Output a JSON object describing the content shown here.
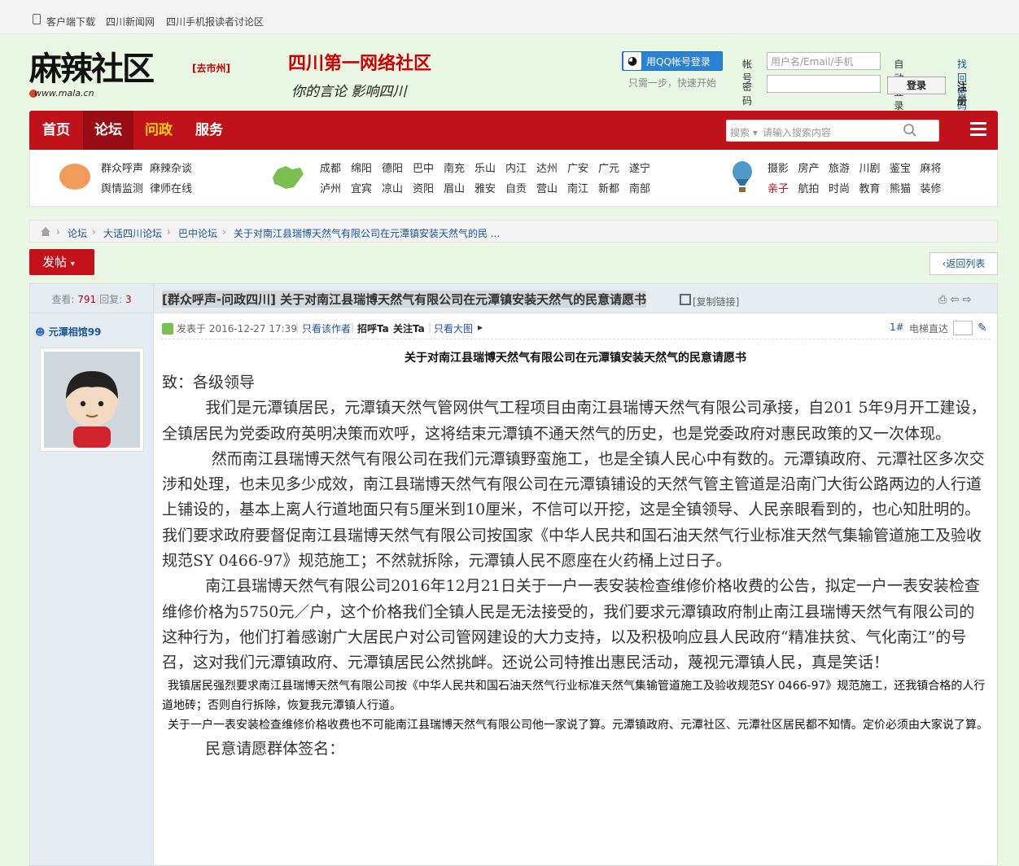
{
  "topbar": {
    "client_download": "客户端下载",
    "sichuan_news": "四川新闻网",
    "reader_forum": "四川手机报读者讨论区"
  },
  "header": {
    "logo_text": "麻辣社区",
    "logo_url": "www.mala.cn",
    "city_link": "[去市州]",
    "slogan_main": "四川第一网络社区",
    "slogan_sub": "你的言论 影响四川",
    "qq_login": "用QQ帐号登录",
    "qq_tip": "只需一步，快速开始",
    "account_label": "帐号",
    "account_placeholder": "用户名/Email/手机",
    "password_label": "密码",
    "auto_login": "自动登录",
    "find_password": "找回密码",
    "login_button": "登录",
    "register": "注册"
  },
  "nav": {
    "home": "首页",
    "forum": "论坛",
    "wenzheng": "问政",
    "service": "服务",
    "search_label": "搜索",
    "search_placeholder": "请输入搜索内容"
  },
  "subnav": {
    "group1": [
      "群众呼声",
      "麻辣杂谈",
      "舆情监测",
      "律师在线"
    ],
    "cities_row1": [
      "成都",
      "绵阳",
      "德阳",
      "巴中",
      "南充",
      "乐山",
      "内江",
      "达州",
      "广安",
      "广元",
      "遂宁"
    ],
    "cities_row2": [
      "泸州",
      "宜宾",
      "凉山",
      "资阳",
      "眉山",
      "雅安",
      "自贡",
      "营山",
      "南江",
      "新都",
      "南部"
    ],
    "topics_row1": [
      "摄影",
      "房产",
      "旅游",
      "川剧",
      "鉴宝",
      "麻将"
    ],
    "topics_row2": [
      "亲子",
      "航拍",
      "时尚",
      "教育",
      "熊猫",
      "装修"
    ]
  },
  "breadcrumb": [
    "论坛",
    "大话四川论坛",
    "巴中论坛",
    "关于对南江县瑞博天然气有限公司在元潭镇安装天然气的民 ..."
  ],
  "actions": {
    "post_button": "发帖",
    "back_to_list": "返回列表"
  },
  "thread": {
    "views_label": "查看:",
    "views": "791",
    "replies_label": "回复:",
    "replies": "3",
    "title": "[群众呼声-问政四川] 关于对南江县瑞博天然气有限公司在元潭镇安装天然气的民意请愿书",
    "copy_link": "[复制链接]"
  },
  "post": {
    "author": "元潭相馆99",
    "posted_at": "发表于 2016-12-27 17:39",
    "only_author": "只看该作者",
    "greet": "招呼Ta",
    "follow": "关注Ta",
    "only_big_image": "只看大图",
    "floor": "1#",
    "elevator": "电梯直达",
    "body_title": "关于对南江县瑞博天然气有限公司在元潭镇安装天然气的民意请愿书",
    "p1": "致：各级领导",
    "p2": "我们是元潭镇居民，元潭镇天然气管网供气工程项目由南江县瑞博天然气有限公司承接，自201 5年9月开工建设，全镇居民为党委政府英明决策而欢呼，这将结束元潭镇不通天然气的历史，也是党委政府对惠民政策的又一次体现。",
    "p3": "然而南江县瑞博天然气有限公司在我们元潭镇野蛮施工，也是全镇人民心中有数的。元潭镇政府、元潭社区多次交涉和处理，也未见多少成效，南江县瑞博天然气有限公司在元潭镇铺设的天然气管主管道是沿南门大街公路两边的人行道上铺设的，基本上离人行道地面只有5厘米到10厘米，不信可以开挖，这是全镇领导、人民亲眼看到的，也心知肚明的。我们要求政府要督促南江县瑞博天然气有限公司按国家《中华人民共和国石油天然气行业标准天然气集输管道施工及验收规范SY 0466-97》规范施工；不然就拆除，元潭镇人民不愿座在火药桶上过日子。",
    "p4": "南江县瑞博天然气有限公司2016年12月21日关于一户一表安装检查维修价格收费的公告，拟定一户一表安装检查维修价格为5750元／户，这个价格我们全镇人民是无法接受的，我们要求元潭镇政府制止南江县瑞博天然气有限公司的这种行为，他们打着感谢广大居民户对公司管网建设的大力支持，以及积极响应县人民政府“精准扶贫、气化南江”的号召，这对我们元潭镇政府、元潭镇居民公然挑衅。还说公司特推出惠民活动，蔑视元潭镇人民，真是笑话！",
    "p5": "我镇居民强烈要求南江县瑞博天然气有限公司按《中华人民共和国石油天然气行业标准天然气集输管道施工及验收规范SY 0466-97》规范施工，还我镇合格的人行道地砖；否则自行拆除，恢复我元潭镇人行道。",
    "p6": "关于一户一表安装检查维修价格收费也不可能南江县瑞博天然气有限公司他一家说了算。元潭镇政府、元潭社区、元潭社区居民都不知情。定价必须由大家说了算。",
    "p7": "民意请愿群体签名："
  },
  "colors": {
    "nav_red": "#c0121a",
    "nav_active": "#970d13",
    "link_blue": "#1a56a0",
    "wenzheng_yellow": "#ffd400"
  }
}
